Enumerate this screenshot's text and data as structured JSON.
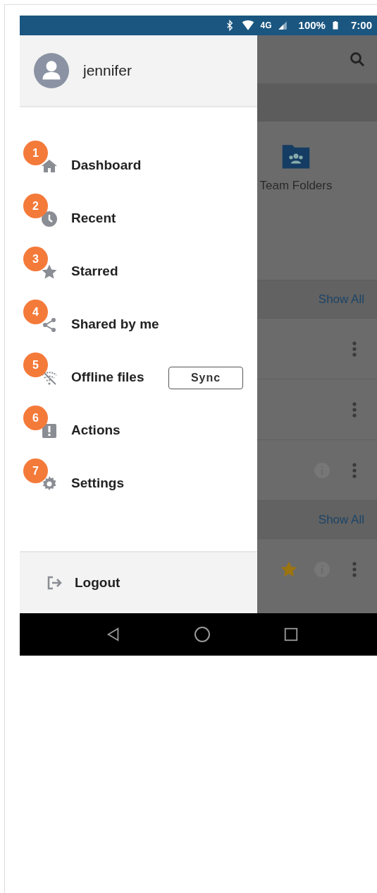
{
  "status_bar": {
    "network": "4G",
    "battery": "100%",
    "time": "7:00"
  },
  "drawer": {
    "user": {
      "name": "jennifer"
    },
    "items": [
      {
        "badge": "1",
        "label": "Dashboard"
      },
      {
        "badge": "2",
        "label": "Recent"
      },
      {
        "badge": "3",
        "label": "Starred"
      },
      {
        "badge": "4",
        "label": "Shared by me"
      },
      {
        "badge": "5",
        "label": "Offline files",
        "action": "Sync"
      },
      {
        "badge": "6",
        "label": "Actions"
      },
      {
        "badge": "7",
        "label": "Settings"
      }
    ],
    "footer": {
      "label": "Logout"
    }
  },
  "background": {
    "folders": [
      {
        "label": "Team Folders"
      }
    ],
    "sections": [
      {
        "action": "Show All",
        "rows": [
          {
            "starred": false,
            "info": false
          },
          {
            "starred": false,
            "info": false
          },
          {
            "starred": false,
            "info": true
          }
        ]
      },
      {
        "action": "Show All",
        "rows": [
          {
            "starred": true,
            "info": true
          }
        ]
      }
    ]
  }
}
